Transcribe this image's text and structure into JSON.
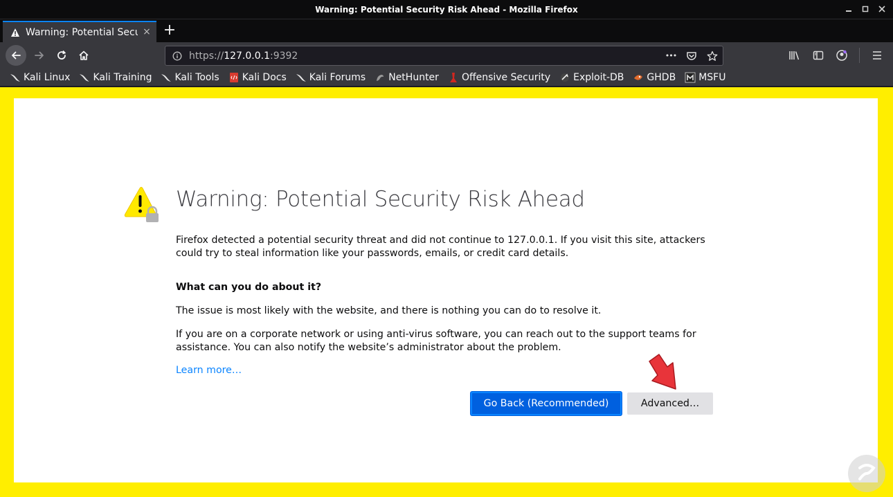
{
  "window": {
    "title": "Warning: Potential Security Risk Ahead - Mozilla Firefox",
    "controls": [
      "minimize-icon",
      "maximize-icon",
      "close-icon"
    ]
  },
  "tab": {
    "title": "Warning: Potential Security Risk Ahead",
    "close_glyph": "×"
  },
  "newtab_glyph": "+",
  "urlbar": {
    "scheme": "https://",
    "host": "127.0.0.1",
    "port": ":9392",
    "more_glyph": "•••"
  },
  "bookmarks": [
    {
      "label": "Kali Linux",
      "icon": "kali-dragon-icon"
    },
    {
      "label": "Kali Training",
      "icon": "kali-dragon-icon"
    },
    {
      "label": "Kali Tools",
      "icon": "kali-dragon-icon"
    },
    {
      "label": "Kali Docs",
      "icon": "kali-docs-icon"
    },
    {
      "label": "Kali Forums",
      "icon": "kali-dragon-icon"
    },
    {
      "label": "NetHunter",
      "icon": "nethunter-icon"
    },
    {
      "label": "Offensive Security",
      "icon": "offsec-icon"
    },
    {
      "label": "Exploit-DB",
      "icon": "exploitdb-icon"
    },
    {
      "label": "GHDB",
      "icon": "ghdb-icon"
    },
    {
      "label": "MSFU",
      "icon": "msfu-icon"
    }
  ],
  "error_page": {
    "heading": "Warning: Potential Security Risk Ahead",
    "intro": "Firefox detected a potential security threat and did not continue to 127.0.0.1. If you visit this site, attackers could try to steal information like your passwords, emails, or credit card details.",
    "what_heading": "What can you do about it?",
    "p_issue": "The issue is most likely with the website, and there is nothing you can do to resolve it.",
    "p_corporate": "If you are on a corporate network or using anti-virus software, you can reach out to the support teams for assistance. You can also notify the website’s administrator about the problem.",
    "learn_more": "Learn more…",
    "go_back_label": "Go Back (Recommended)",
    "advanced_label": "Advanced…"
  },
  "colors": {
    "highlight_border": "#ffee00",
    "primary_button": "#0060df",
    "link": "#0a84ff",
    "arrow": "#e8343a"
  }
}
